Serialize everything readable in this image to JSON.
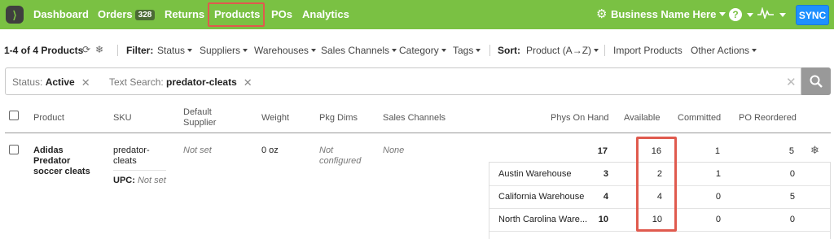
{
  "nav": {
    "items": [
      {
        "label": "Dashboard"
      },
      {
        "label": "Orders",
        "badge": "328"
      },
      {
        "label": "Returns"
      },
      {
        "label": "Products",
        "active": true
      },
      {
        "label": "POs"
      },
      {
        "label": "Analytics"
      }
    ],
    "business_name": "Business Name Here",
    "help_icon": "?",
    "sync_label": "SYNC",
    "accent_color": "#7ac143",
    "sync_color": "#1e90ff",
    "highlight_color": "#e05a4e"
  },
  "toolbar": {
    "count": "1-4 of 4 Products",
    "filter_label": "Filter:",
    "filters": [
      "Status",
      "Suppliers",
      "Warehouses",
      "Sales Channels",
      "Category",
      "Tags"
    ],
    "sort_label": "Sort:",
    "sort_value": "Product (A→Z)",
    "import": "Import Products",
    "other_actions": "Other Actions"
  },
  "search": {
    "chips": [
      {
        "label": "Status:",
        "value": "Active"
      },
      {
        "label": "Text Search:",
        "value": "predator-cleats"
      }
    ]
  },
  "table": {
    "headers": {
      "product": "Product",
      "sku": "SKU",
      "default_supplier": "Default Supplier",
      "weight": "Weight",
      "pkg_dims": "Pkg Dims",
      "sales_channels": "Sales Channels",
      "phys_on_hand": "Phys On Hand",
      "available": "Available",
      "committed": "Committed",
      "po_reordered": "PO Reordered"
    },
    "rows": [
      {
        "product": "Adidas Predator soccer cleats",
        "sku": "predator-cleats",
        "upc_label": "UPC:",
        "upc_value": "Not set",
        "default_supplier": "Not set",
        "weight": "0 oz",
        "pkg_dims": "Not configured",
        "sales_channels": "None",
        "phys_on_hand": "17",
        "available": "16",
        "committed": "1",
        "po_reordered": "5",
        "warehouses": [
          {
            "name": "Austin Warehouse",
            "phys_on_hand": "3",
            "available": "2",
            "committed": "1",
            "po_reordered": "0"
          },
          {
            "name": "California Warehouse",
            "phys_on_hand": "4",
            "available": "4",
            "committed": "0",
            "po_reordered": "5"
          },
          {
            "name": "North Carolina Ware...",
            "phys_on_hand": "10",
            "available": "10",
            "committed": "0",
            "po_reordered": "0"
          }
        ]
      }
    ]
  }
}
